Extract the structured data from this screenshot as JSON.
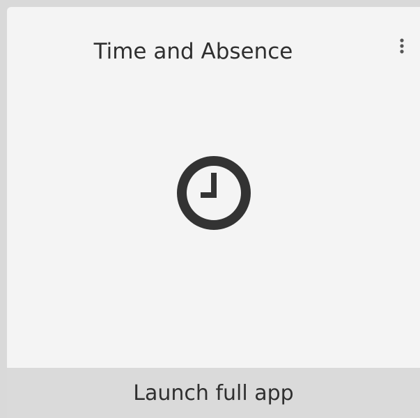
{
  "tile": {
    "title": "Time and Absence",
    "icon": "clock-icon",
    "menu_icon": "vertical-ellipsis-icon",
    "launch_label": "Launch full app"
  },
  "colors": {
    "tile_background": "#f4f4f4",
    "launch_bar_background": "#dadada",
    "text": "#2f2f2f",
    "icon": "#333333",
    "page_background": "#d9d9d9"
  }
}
